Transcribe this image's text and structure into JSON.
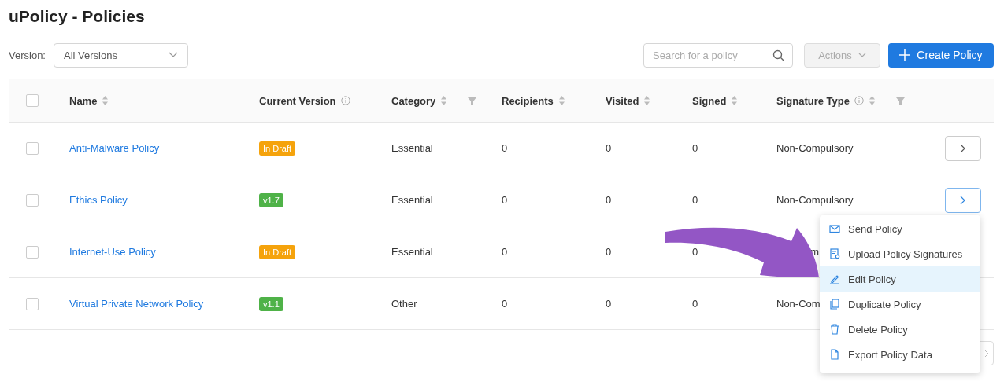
{
  "title": "uPolicy - Policies",
  "version_filter": {
    "label": "Version:",
    "value": "All Versions"
  },
  "search": {
    "placeholder": "Search for a policy"
  },
  "actions_button": {
    "label": "Actions",
    "disabled": true
  },
  "create_button": {
    "label": "Create Policy"
  },
  "table": {
    "select_all_checked": false,
    "columns": [
      {
        "label": "Name",
        "info": false,
        "sortable": true,
        "filter": false
      },
      {
        "label": "Current Version",
        "info": true,
        "sortable": false,
        "filter": false
      },
      {
        "label": "Category",
        "info": false,
        "sortable": true,
        "filter": true
      },
      {
        "label": "Recipients",
        "info": false,
        "sortable": true,
        "filter": false
      },
      {
        "label": "Visited",
        "info": false,
        "sortable": true,
        "filter": false
      },
      {
        "label": "Signed",
        "info": false,
        "sortable": true,
        "filter": false
      },
      {
        "label": "Signature Type",
        "info": true,
        "sortable": true,
        "filter": true
      }
    ],
    "rows": [
      {
        "checked": false,
        "name": "Anti-Malware Policy",
        "version": {
          "kind": "draft",
          "label": "In Draft"
        },
        "category": "Essential",
        "recipients": "0",
        "visited": "0",
        "signed": "0",
        "signature_type": "Non-Compulsory",
        "menu_open": false
      },
      {
        "checked": false,
        "name": "Ethics Policy",
        "version": {
          "kind": "version",
          "label": "v1.7"
        },
        "category": "Essential",
        "recipients": "0",
        "visited": "0",
        "signed": "0",
        "signature_type": "Non-Compulsory",
        "menu_open": true
      },
      {
        "checked": false,
        "name": "Internet-Use Policy",
        "version": {
          "kind": "draft",
          "label": "In Draft"
        },
        "category": "Essential",
        "recipients": "0",
        "visited": "0",
        "signed": "0",
        "signature_type": "m"
      },
      {
        "checked": false,
        "name": "Virtual Private Network Policy",
        "version": {
          "kind": "version",
          "label": "v1.1"
        },
        "category": "Other",
        "recipients": "0",
        "visited": "0",
        "signed": "0",
        "signature_type": "Non-Com"
      }
    ]
  },
  "row_menu": {
    "items": [
      {
        "kind": "send",
        "label": "Send Policy",
        "selected": false
      },
      {
        "kind": "upload",
        "label": "Upload Policy Signatures",
        "selected": false
      },
      {
        "kind": "edit",
        "label": "Edit Policy",
        "selected": true
      },
      {
        "kind": "duplicate",
        "label": "Duplicate Policy",
        "selected": false
      },
      {
        "kind": "delete",
        "label": "Delete Policy",
        "selected": false
      },
      {
        "kind": "export",
        "label": "Export Policy Data",
        "selected": false
      }
    ]
  }
}
